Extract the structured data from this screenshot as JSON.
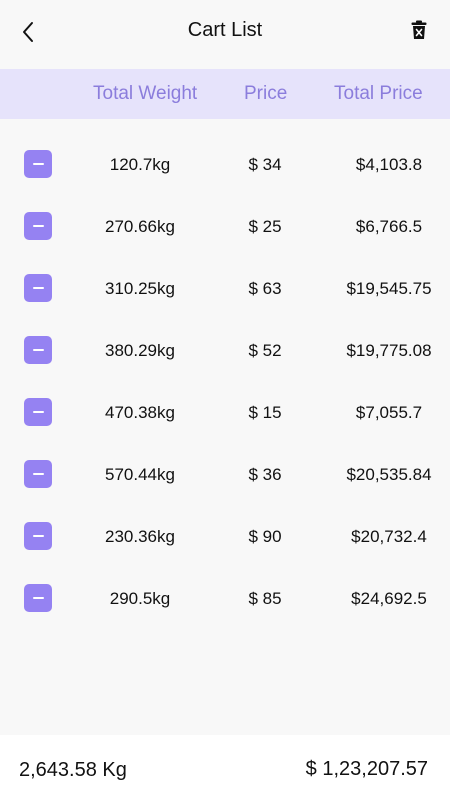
{
  "header": {
    "title": "Cart List",
    "back_icon": "chevron-left-icon",
    "delete_icon": "trash-icon"
  },
  "columns": {
    "weight": "Total Weight",
    "price": "Price",
    "total": "Total Price"
  },
  "rows": [
    {
      "weight": "120.7kg",
      "price": "$ 34",
      "total": "$4,103.8"
    },
    {
      "weight": "270.66kg",
      "price": "$ 25",
      "total": "$6,766.5"
    },
    {
      "weight": "310.25kg",
      "price": "$ 63",
      "total": "$19,545.75"
    },
    {
      "weight": "380.29kg",
      "price": "$ 52",
      "total": "$19,775.08"
    },
    {
      "weight": "470.38kg",
      "price": "$ 15",
      "total": "$7,055.7"
    },
    {
      "weight": "570.44kg",
      "price": "$ 36",
      "total": "$20,535.84"
    },
    {
      "weight": "230.36kg",
      "price": "$ 90",
      "total": "$20,732.4"
    },
    {
      "weight": "290.5kg",
      "price": "$ 85",
      "total": "$24,692.5"
    }
  ],
  "footer": {
    "total_weight": "2,643.58 Kg",
    "grand_total": "$ 1,23,207.57"
  },
  "colors": {
    "accent": "#9582f2",
    "header_bg": "#e6e3fb",
    "header_text": "#8b7ddc"
  }
}
